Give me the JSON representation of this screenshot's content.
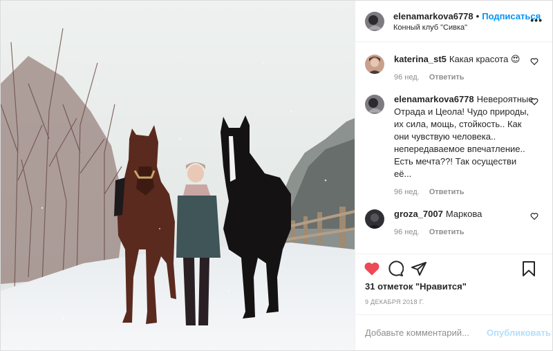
{
  "post": {
    "author": "elenamarkova6778",
    "follow_label": "Подписаться",
    "separator": "•",
    "location": "Конный клуб \"Сивка\"",
    "more_label": "•••"
  },
  "comments": [
    {
      "user": "katerina_st5",
      "text": "Какая красота 😍",
      "age": "96 нед.",
      "reply": "Ответить"
    },
    {
      "user": "elenamarkova6778",
      "text": "Невероятные Отрада и Цеола! Чудо природы, их сила, мощь, стойкость.. Как они чувствую человека.. непередаваемое впечатление.. Есть мечта??! Так осуществи её...",
      "age": "96 нед.",
      "reply": "Ответить"
    },
    {
      "user": "groza_7007",
      "text": "Маркова",
      "age": "96 нед.",
      "reply": "Ответить"
    }
  ],
  "likes_text": "31 отметок \"Нравится\"",
  "date_text": "9 ДЕКАБРЯ 2018 Г.",
  "add_comment": {
    "placeholder": "Добавьте комментарий...",
    "post_label": "Опубликовать"
  },
  "icons": {
    "like": "heart-filled-icon",
    "comment": "comment-icon",
    "share": "share-icon",
    "save": "bookmark-icon",
    "comment_like": "heart-outline-icon"
  },
  "colors": {
    "like_red": "#ed4956",
    "link_blue": "#0095f6",
    "post_disabled": "#b2dffc",
    "muted": "#8e8e8e"
  }
}
